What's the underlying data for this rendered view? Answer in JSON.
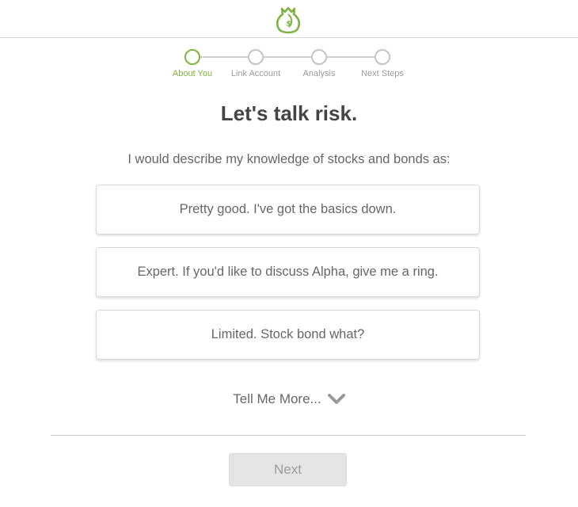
{
  "stepper": {
    "steps": [
      {
        "label": "About You",
        "active": true
      },
      {
        "label": "Link Account",
        "active": false
      },
      {
        "label": "Analysis",
        "active": false
      },
      {
        "label": "Next Steps",
        "active": false
      }
    ]
  },
  "main": {
    "title": "Let's talk risk.",
    "question": "I would describe my knowledge of stocks and bonds as:",
    "options": [
      "Pretty good. I've got the basics down.",
      "Expert. If you'd like to discuss Alpha, give me a ring.",
      "Limited. Stock bond what?"
    ],
    "tell_more": "Tell Me More..."
  },
  "footer": {
    "next_label": "Next"
  },
  "colors": {
    "accent": "#7cb342",
    "inactive_step": "#c4c4c4",
    "disabled_button": "#e4e4e4"
  },
  "icons": [
    "money-bag-logo-icon",
    "chevron-down-icon"
  ]
}
